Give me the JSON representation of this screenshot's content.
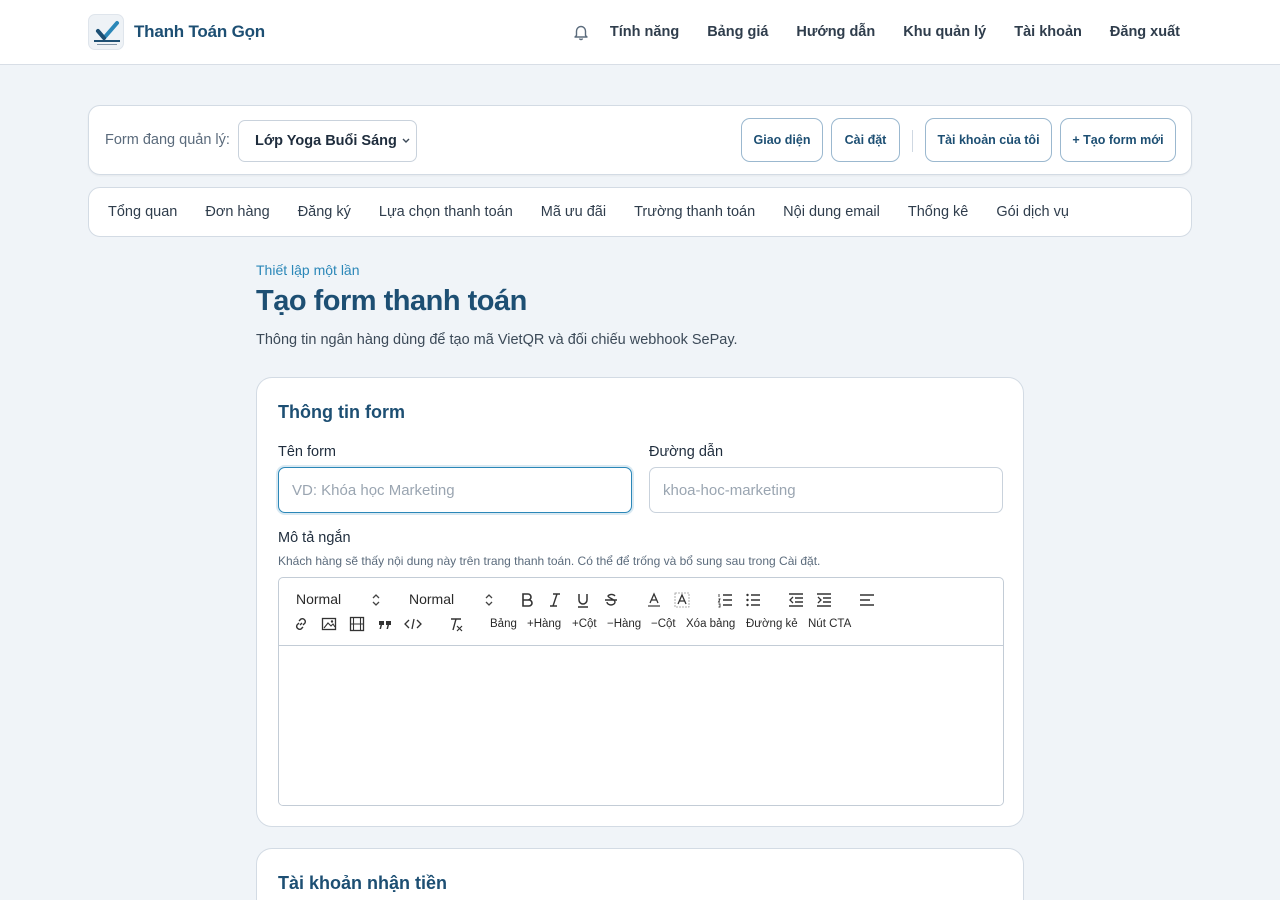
{
  "brand": {
    "name": "Thanh Toán Gọn"
  },
  "nav": {
    "links": [
      "Tính năng",
      "Bảng giá",
      "Hướng dẫn",
      "Khu quản lý",
      "Tài khoản",
      "Đăng xuất"
    ]
  },
  "formbar": {
    "label": "Form đang quản lý:",
    "selected": "Lớp Yoga Buổi Sáng",
    "buttons": [
      "Giao diện",
      "Cài đặt",
      "Tài khoản của tôi",
      "+ Tạo form mới"
    ]
  },
  "tabs": [
    "Tổng quan",
    "Đơn hàng",
    "Đăng ký",
    "Lựa chọn thanh toán",
    "Mã ưu đãi",
    "Trường thanh toán",
    "Nội dung email",
    "Thống kê",
    "Gói dịch vụ"
  ],
  "header": {
    "eyebrow": "Thiết lập một lần",
    "title": "Tạo form thanh toán",
    "subtitle": "Thông tin ngân hàng dùng để tạo mã VietQR và đối chiếu webhook SePay."
  },
  "form_info": {
    "title": "Thông tin form",
    "name_label": "Tên form",
    "name_placeholder": "VD: Khóa học Marketing",
    "slug_label": "Đường dẫn",
    "slug_placeholder": "khoa-hoc-marketing",
    "desc_label": "Mô tả ngắn",
    "desc_hint": "Khách hàng sẽ thấy nội dung này trên trang thanh toán. Có thể để trống và bổ sung sau trong Cài đặt."
  },
  "editor": {
    "header_select": "Normal",
    "size_select": "Normal",
    "text_buttons": [
      "Bảng",
      "+Hàng",
      "+Cột",
      "−Hàng",
      "−Cột",
      "Xóa bảng",
      "Đường kẻ",
      "Nút CTA"
    ]
  },
  "account": {
    "title": "Tài khoản nhận tiền"
  },
  "colors": {
    "primary": "#1d4f73",
    "accent": "#2b87b8",
    "background": "#f0f4f8"
  }
}
